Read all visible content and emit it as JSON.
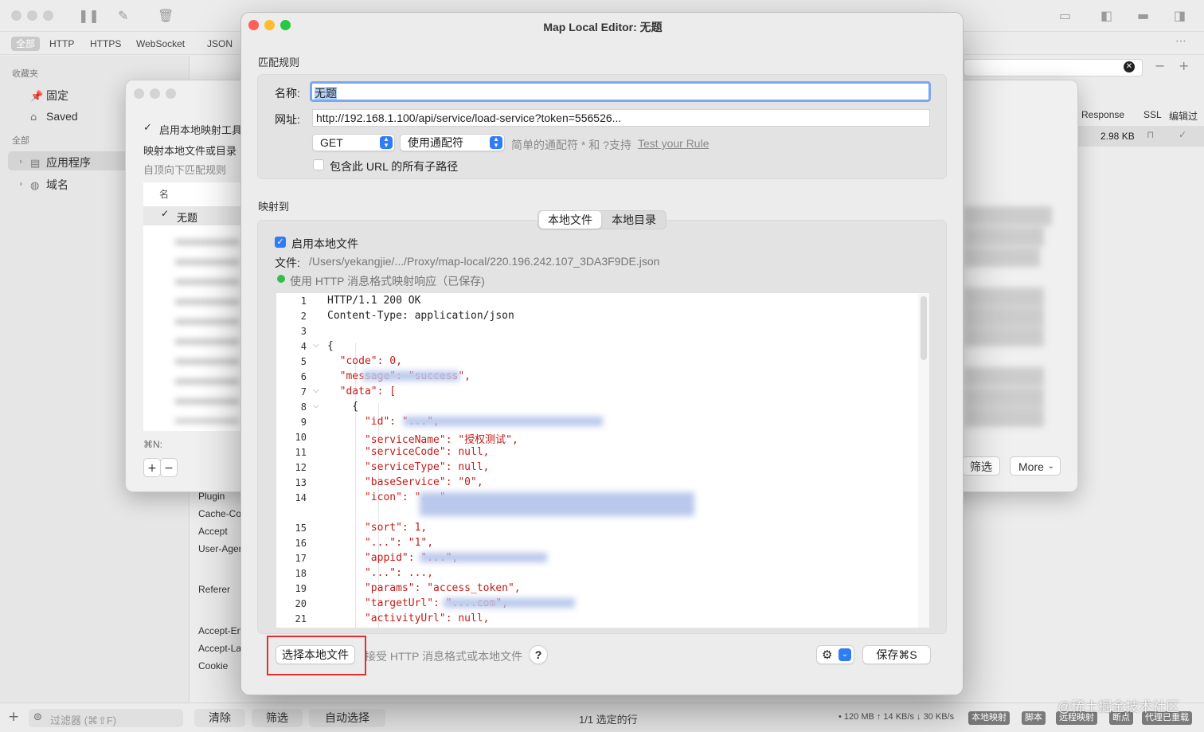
{
  "main": {
    "filter_tabs": [
      "全部",
      "HTTP",
      "HTTPS",
      "WebSocket",
      "JSON"
    ],
    "sidebar": {
      "favorites_heading": "收藏夹",
      "favorites": [
        "固定",
        "Saved"
      ],
      "all_heading": "全部",
      "all_items": [
        "应用程序",
        "域名"
      ]
    },
    "right_columns": [
      "Response",
      "SSL",
      "编辑过"
    ],
    "right_row_size": "2.98 KB",
    "right_list_suffixes": [
      "F9l...on",
      "31...son",
      "...",
      "",
      "on",
      "on",
      "...on",
      "",
      "son",
      "son",
      "7...son"
    ],
    "detail_labels": [
      "Plugin",
      "Cache-Co",
      "Accept",
      "User-Agen",
      "Referer",
      "Accept-En",
      "Accept-La",
      "Cookie"
    ],
    "status": {
      "filter_placeholder": "过滤器 (⌘⇧F)",
      "buttons": [
        "清除",
        "筛选",
        "自动选择"
      ],
      "selection": "1/1 选定的行",
      "traffic": "• 120 MB ↑ 14 KB/s ↓ 30 KB/s",
      "badges": [
        "本地映射",
        "脚本",
        "远程映射",
        "断点",
        "代理已重载"
      ]
    }
  },
  "list_dialog": {
    "enable_label": "启用本地映射工具",
    "desc1": "映射本地文件或目录",
    "desc2": "自顶向下匹配规则",
    "col_name": "名",
    "first_row": "无题",
    "shortcut": "⌘N:",
    "filter_button": "筛选",
    "more_button": "More"
  },
  "editor": {
    "title": "Map Local Editor: 无题",
    "match_section": "匹配规则",
    "name_label": "名称:",
    "name_value": "无题",
    "url_label": "网址:",
    "url_value": "http://192.168.1.100/api/service/load-service?token=556526...",
    "method": "GET",
    "wildcard": "使用通配符",
    "wildcard_hint": "简单的通配符 * 和 ?支持",
    "test_rule": "Test your Rule",
    "include_subpaths": "包含此 URL 的所有子路径",
    "map_to_section": "映射到",
    "tabs": [
      "本地文件",
      "本地目录"
    ],
    "enable_local_file": "启用本地文件",
    "file_label": "文件:",
    "file_path": "/Users/yekangjie/.../Proxy/map-local/220.196.242.107_3DA3F9DE.json",
    "saved_status": "使用 HTTP 消息格式映射响应（已保存)",
    "code_lines": [
      {
        "n": "1",
        "t": "HTTP/1.1 200 OK"
      },
      {
        "n": "2",
        "t": "Content-Type: application/json"
      },
      {
        "n": "3",
        "t": ""
      },
      {
        "n": "4",
        "t": "{"
      },
      {
        "n": "5",
        "t": "  \"code\": 0,"
      },
      {
        "n": "6",
        "t": "  \"message\": \"success\","
      },
      {
        "n": "7",
        "t": "  \"data\": ["
      },
      {
        "n": "8",
        "t": "    {"
      },
      {
        "n": "9",
        "t": "      \"id\": \"...\","
      },
      {
        "n": "10",
        "t": "      \"serviceName\": \"授权测试\","
      },
      {
        "n": "11",
        "t": "      \"serviceCode\": null,"
      },
      {
        "n": "12",
        "t": "      \"serviceType\": null,"
      },
      {
        "n": "13",
        "t": "      \"baseService\": \"0\","
      },
      {
        "n": "14",
        "t": "      \"icon\": \"...\","
      },
      {
        "n": "15",
        "t": "      \"sort\": 1,"
      },
      {
        "n": "16",
        "t": "      \"...\": \"1\","
      },
      {
        "n": "17",
        "t": "      \"appid\": \"...\","
      },
      {
        "n": "18",
        "t": "      \"...\": ...,"
      },
      {
        "n": "19",
        "t": "      \"params\": \"access_token\","
      },
      {
        "n": "20",
        "t": "      \"targetUrl\": \"....com\","
      },
      {
        "n": "21",
        "t": "      \"activityUrl\": null,"
      }
    ],
    "choose_file_button": "选择本地文件",
    "choose_hint": "接受 HTTP 消息格式或本地文件",
    "help": "?",
    "save_button": "保存⌘S"
  },
  "watermark": "@稀土掘金技术社区",
  "colors": {
    "accent": "#2f7cf6",
    "highlight_box": "#e0302f",
    "status_green": "#2fbf4a",
    "json_key": "#c41a16",
    "json_string": "#1c00cf",
    "json_keyword": "#aa0d91"
  }
}
